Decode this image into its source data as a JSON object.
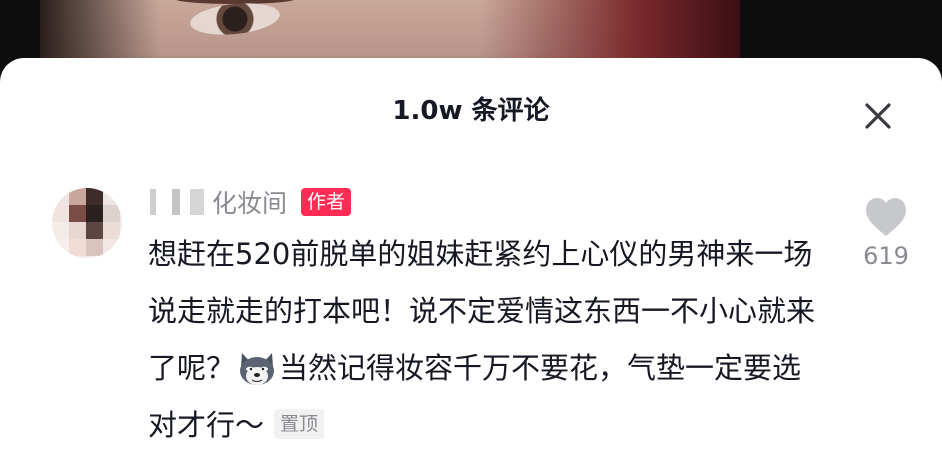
{
  "sheet": {
    "title": "1.0w 条评论"
  },
  "comment": {
    "username": "化妆间",
    "author_badge": "作者",
    "text_part1": "想赶在520前脱单的姐妹赶紧约上心仪的男神来一场说走就走的打本吧！说不定爱情这东西一不小心就来了呢？",
    "text_part2": "当然记得妆容千万不要花，气垫一定要选对才行～",
    "emoji": "dog-emoji",
    "pin_label": "置顶",
    "like_count": "619"
  },
  "icons": {
    "close": "close-icon",
    "like": "heart-icon"
  },
  "colors": {
    "accent": "#fe2c55",
    "text_primary": "#161823",
    "text_secondary": "#8a8b91"
  }
}
